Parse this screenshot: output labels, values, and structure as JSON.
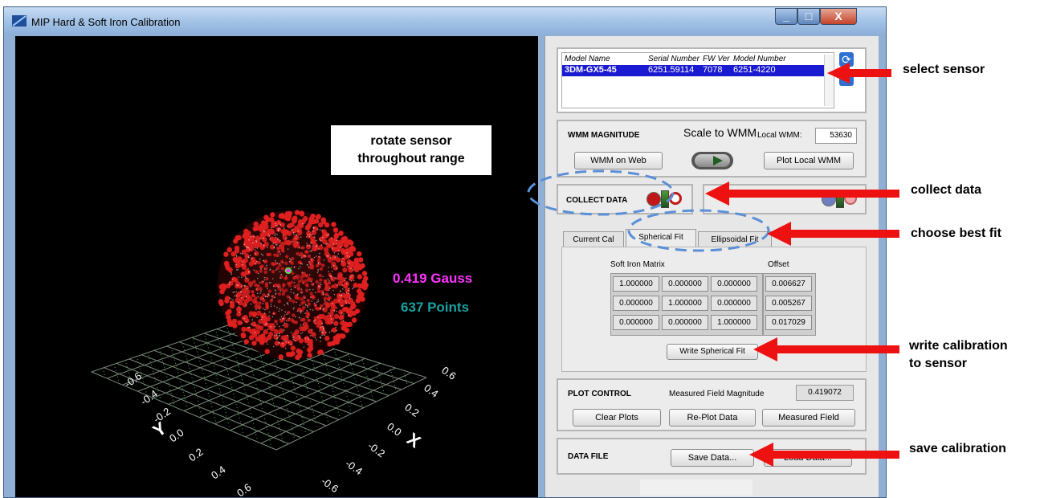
{
  "window": {
    "title": "MIP Hard & Soft Iron Calibration",
    "controls": {
      "minimize": "_",
      "maximize": "□",
      "close": "X"
    }
  },
  "viewport": {
    "callout": "rotate sensor\nthroughout range",
    "magnitude_text": "0.419 Gauss",
    "points_text": "637 Points",
    "magnitude_color": "#ff33ff",
    "points_color": "#1aa0a0",
    "sphere_color": "#e02020",
    "grid_color": "#7a8a7a",
    "axis_y_label": "Y",
    "axis_x_label": "X",
    "left_ticks": [
      "-0.6",
      "-0.4",
      "-0.2",
      "0.0",
      "0.2",
      "0.4",
      "0.6"
    ],
    "right_ticks": [
      "0.6",
      "0.4",
      "0.2",
      "0.0",
      "-0.2",
      "-0.4",
      "-0.6"
    ]
  },
  "sensor_table": {
    "headers": [
      "Model Name",
      "Serial Number",
      "FW Ver",
      "Model Number"
    ],
    "rows": [
      [
        "3DM-GX5-45",
        "6251.59114",
        "7078",
        "6251-4220"
      ]
    ],
    "refresh_icon": "refresh-icon",
    "help_icon": "help-icon"
  },
  "wmm": {
    "title": "WMM MAGNITUDE",
    "scale_label": "Scale to WMM",
    "local_label": "Local WMM:",
    "local_value": "53630",
    "web_button": "WMM on Web",
    "plot_button": "Plot Local WMM"
  },
  "collect": {
    "title": "COLLECT DATA"
  },
  "tabs": {
    "items": [
      "Current Cal",
      "Spherical Fit",
      "Ellipsoidal Fit"
    ],
    "active": 1
  },
  "fit": {
    "matrix_label": "Soft Iron Matrix",
    "offset_label": "Offset",
    "matrix": [
      [
        "1.000000",
        "0.000000",
        "0.000000"
      ],
      [
        "0.000000",
        "1.000000",
        "0.000000"
      ],
      [
        "0.000000",
        "0.000000",
        "1.000000"
      ]
    ],
    "offset": [
      "0.006627",
      "0.005267",
      "0.017029"
    ],
    "write_button": "Write Spherical Fit"
  },
  "plot_control": {
    "title": "PLOT CONTROL",
    "measured_label": "Measured Field Magnitude",
    "measured_value": "0.419072",
    "buttons": [
      "Clear Plots",
      "Re-Plot Data",
      "Measured Field"
    ]
  },
  "data_file": {
    "title": "DATA FILE",
    "save_button": "Save Data...",
    "load_button": "Load Data..."
  },
  "annotations": {
    "select_sensor": "select sensor",
    "collect_data": "collect data",
    "choose_best_fit": "choose best fit",
    "write_calibration": "write calibration\nto sensor",
    "save_calibration": "save calibration",
    "arrow_color": "#ee1111",
    "dash_color": "#5b8fd6"
  }
}
